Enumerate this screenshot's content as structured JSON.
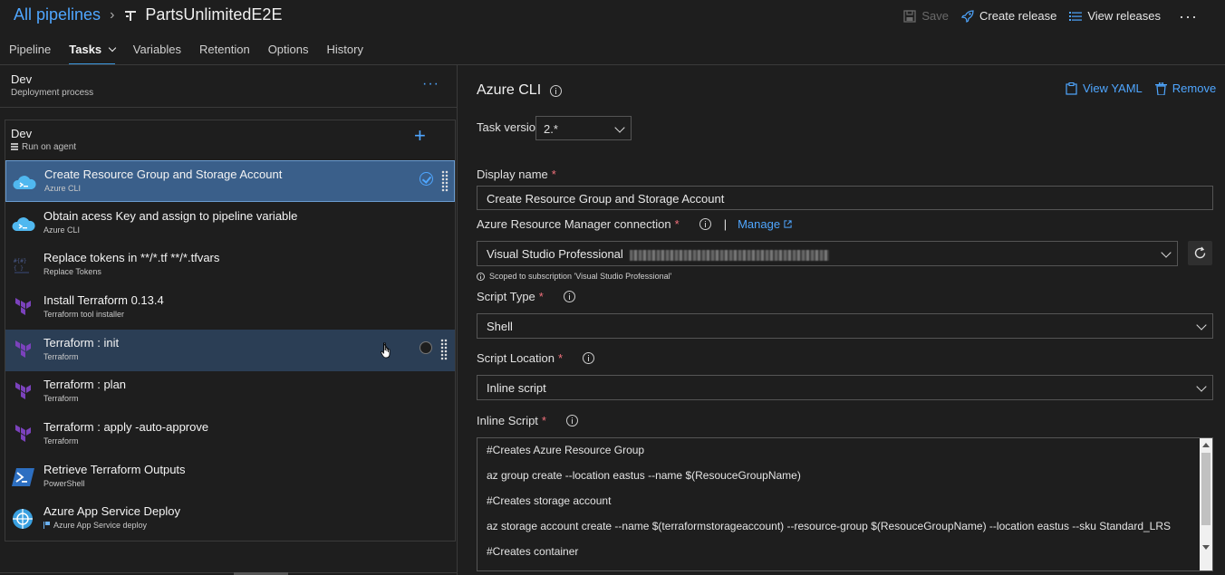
{
  "header": {
    "breadcrumb_root": "All pipelines",
    "pipeline_name": "PartsUnlimitedE2E",
    "actions": {
      "save": "Save",
      "create_release": "Create release",
      "view_releases": "View releases"
    }
  },
  "tabs": [
    {
      "label": "Pipeline"
    },
    {
      "label": "Tasks"
    },
    {
      "label": "Variables"
    },
    {
      "label": "Retention"
    },
    {
      "label": "Options"
    },
    {
      "label": "History"
    }
  ],
  "stage": {
    "name": "Dev",
    "subtitle": "Deployment process"
  },
  "agent_job": {
    "name": "Dev",
    "subtitle": "Run on agent"
  },
  "tasks": [
    {
      "title": "Create Resource Group and Storage Account",
      "subtitle": "Azure CLI",
      "icon": "azure-cli-icon"
    },
    {
      "title": "Obtain acess Key and assign to pipeline variable",
      "subtitle": "Azure CLI",
      "icon": "azure-cli-icon"
    },
    {
      "title": "Replace tokens in **/*.tf **/*.tfvars",
      "subtitle": "Replace Tokens",
      "icon": "replace-tokens-icon"
    },
    {
      "title": "Install Terraform 0.13.4",
      "subtitle": "Terraform tool installer",
      "icon": "terraform-icon"
    },
    {
      "title": "Terraform : init",
      "subtitle": "Terraform",
      "icon": "terraform-icon"
    },
    {
      "title": "Terraform : plan",
      "subtitle": "Terraform",
      "icon": "terraform-icon"
    },
    {
      "title": "Terraform : apply -auto-approve",
      "subtitle": "Terraform",
      "icon": "terraform-icon"
    },
    {
      "title": "Retrieve Terraform Outputs",
      "subtitle": "PowerShell",
      "icon": "powershell-icon"
    },
    {
      "title": "Azure App Service Deploy",
      "subtitle": "Azure App Service deploy",
      "icon": "app-service-icon"
    }
  ],
  "detail": {
    "title": "Azure CLI",
    "view_yaml": "View YAML",
    "remove": "Remove",
    "task_version_label": "Task version",
    "task_version_value": "2.*",
    "display_name_label": "Display name",
    "display_name_value": "Create Resource Group and Storage Account",
    "arm_connection_label": "Azure Resource Manager connection",
    "manage_label": "Manage",
    "arm_connection_value": "Visual Studio Professional",
    "scope_note": "Scoped to subscription 'Visual Studio Professional'",
    "script_type_label": "Script Type",
    "script_type_value": "Shell",
    "script_location_label": "Script Location",
    "script_location_value": "Inline script",
    "inline_script_label": "Inline Script",
    "inline_script_lines": [
      "#Creates Azure Resource Group",
      "az group create --location eastus --name $(ResouceGroupName)",
      "#Creates storage account",
      "az storage account create --name $(terraformstorageaccount) --resource-group $(ResouceGroupName) --location eastus --sku Standard_LRS",
      "#Creates container"
    ]
  },
  "colors": {
    "accent": "#4fa6ff",
    "selected_row": "#3a5f8a",
    "hover_row": "#2b3e55",
    "required": "#f1707b",
    "terraform": "#7b42bc"
  }
}
